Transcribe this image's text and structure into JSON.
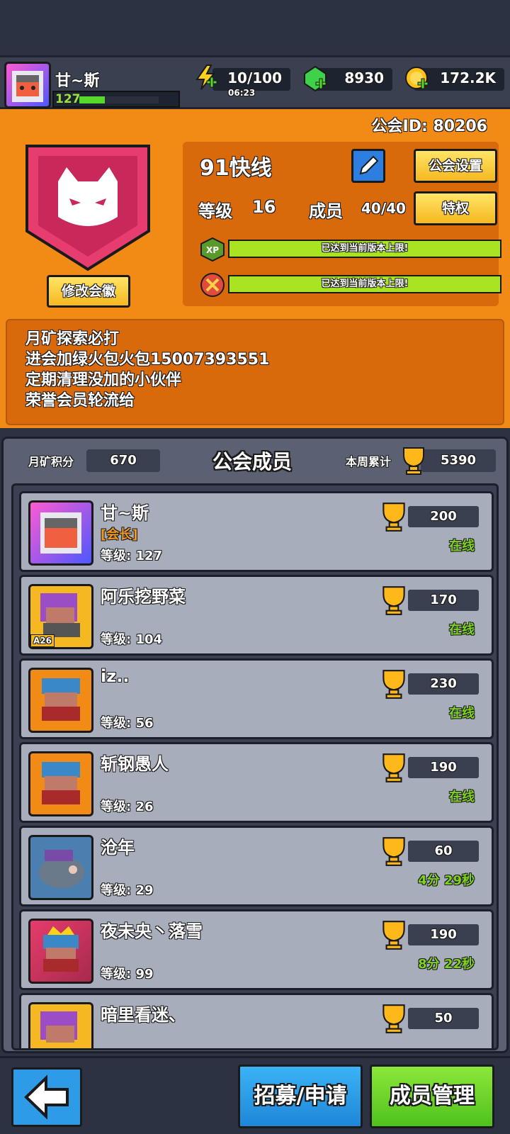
{
  "player": {
    "name": "甘~斯",
    "level": "127",
    "energy": "10/100",
    "energy_timer": "06:23",
    "gems": "8930",
    "gold": "172.2K"
  },
  "guild": {
    "id_label": "公会ID: 80206",
    "name": "91快线",
    "settings_label": "公会设置",
    "level_label": "等级",
    "level_value": "16",
    "members_label": "成员",
    "members_value": "40/40",
    "privilege_label": "特权",
    "edit_emblem_label": "修改会徽",
    "xp_badge": "XP",
    "xp_progress_text": "已达到当前版本上限!",
    "tech_progress_text": "已达到当前版本上限!",
    "notice_lines": [
      "月矿探索必打",
      "进会加绿火包火包15007393551",
      "定期清理没加的小伙伴",
      "荣誉会员轮流给"
    ]
  },
  "members_panel": {
    "title": "公会成员",
    "moon_points_label": "月矿积分",
    "moon_points_value": "670",
    "week_total_label": "本周累计",
    "week_total_value": "5390"
  },
  "members": [
    {
      "name": "甘~斯",
      "role": "[会长]",
      "level": "等级: 127",
      "score": "200",
      "status": "在线"
    },
    {
      "name": "阿乐挖野菜",
      "role": "",
      "level": "等级: 104",
      "score": "170",
      "status": "在线",
      "badge": "A26"
    },
    {
      "name": "iz..",
      "role": "",
      "level": "等级: 56",
      "score": "230",
      "status": "在线"
    },
    {
      "name": "斩钢愚人",
      "role": "",
      "level": "等级: 26",
      "score": "190",
      "status": "在线"
    },
    {
      "name": "沧年",
      "role": "",
      "level": "等级: 29",
      "score": "60",
      "status": "4分 29秒"
    },
    {
      "name": "夜未央丶落雪",
      "role": "",
      "level": "等级: 99",
      "score": "190",
      "status": "8分 22秒"
    },
    {
      "name": "暗里看迷、",
      "role": "",
      "level": "",
      "score": "50",
      "status": ""
    }
  ],
  "bottom": {
    "recruit_label": "招募/申请",
    "manage_label": "成员管理"
  },
  "colors": {
    "orange": "#f28b16",
    "online_green": "#7ed321",
    "button_yellow": "#f5b820",
    "panel_gray": "#a7adbb"
  },
  "icons": {
    "energy": "lightning-plus-icon",
    "gem": "green-gem-plus-icon",
    "gold": "gold-coin-plus-icon",
    "edit": "pencil-icon",
    "trophy": "trophy-icon",
    "back": "arrow-left-icon"
  }
}
